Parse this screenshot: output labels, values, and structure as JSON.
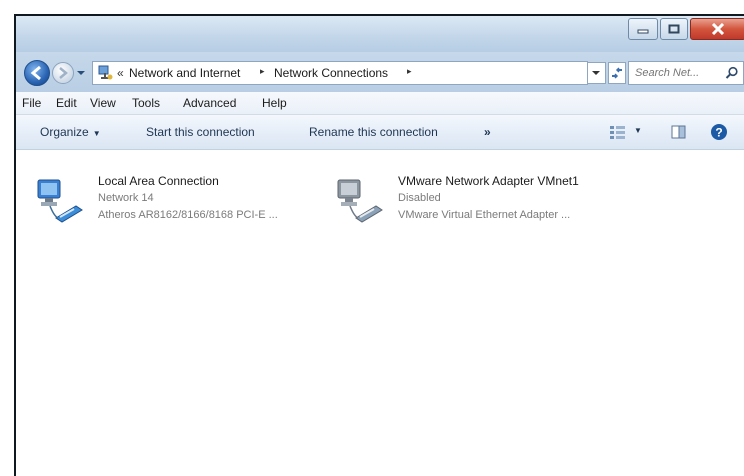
{
  "window": {
    "controls": {
      "minimize": "minimize",
      "maximize": "maximize",
      "close": "close"
    }
  },
  "address_bar": {
    "overflow_chevron": "«",
    "crumbs": [
      "Network and Internet",
      "Network Connections"
    ],
    "separator": "▸",
    "search_placeholder": "Search Net..."
  },
  "menu": {
    "items": [
      "File",
      "Edit",
      "View",
      "Tools",
      "Advanced",
      "Help"
    ]
  },
  "command_bar": {
    "organize": "Organize",
    "start": "Start this connection",
    "rename": "Rename this connection",
    "more": "»"
  },
  "connections": [
    {
      "name": "Local Area Connection",
      "network": "Network 14",
      "adapter": "Atheros AR8162/8166/8168 PCI-E ...",
      "icon": "network-adapter-icon"
    },
    {
      "name": "VMware Network Adapter VMnet1",
      "network": "Disabled",
      "adapter": "VMware Virtual Ethernet Adapter ...",
      "icon": "network-adapter-disabled-icon"
    }
  ],
  "colors": {
    "accent": "#2a64b3",
    "close_button": "#c0392b",
    "command_text": "#1f3653",
    "secondary_text": "#7b7b7b"
  }
}
